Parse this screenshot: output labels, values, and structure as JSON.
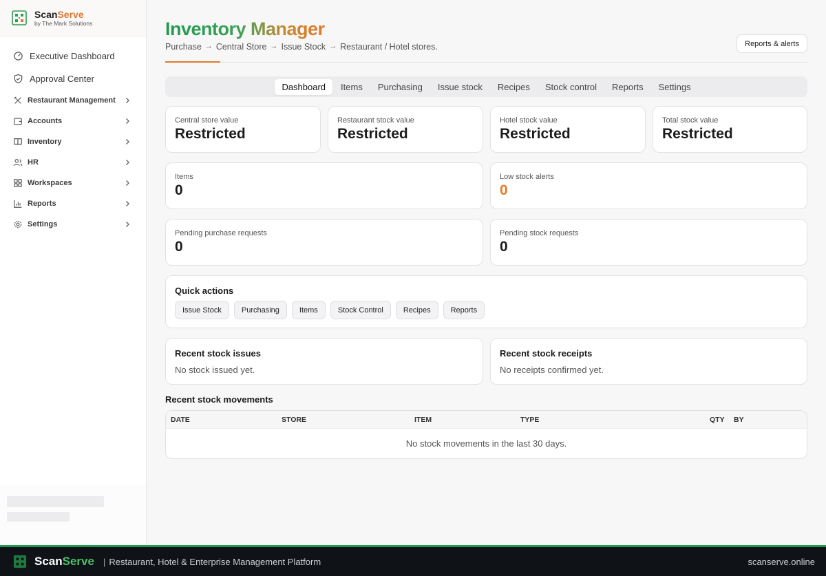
{
  "brand": {
    "name_part1": "Scan",
    "name_part2": "Serve",
    "subtitle": "by The Mark Solutions"
  },
  "sidebar": {
    "top_items": [
      {
        "label": "Executive Dashboard",
        "icon": "activity-icon"
      },
      {
        "label": "Approval Center",
        "icon": "shield-check-icon"
      }
    ],
    "groups": [
      {
        "label": "Restaurant Management",
        "icon": "utensils-icon"
      },
      {
        "label": "Accounts",
        "icon": "wallet-icon"
      },
      {
        "label": "Inventory",
        "icon": "book-icon"
      },
      {
        "label": "HR",
        "icon": "users-icon"
      },
      {
        "label": "Workspaces",
        "icon": "grid-icon"
      },
      {
        "label": "Reports",
        "icon": "bar-chart-icon"
      },
      {
        "label": "Settings",
        "icon": "gear-icon"
      }
    ]
  },
  "header": {
    "title": "Inventory Manager",
    "breadcrumb": [
      "Purchase",
      "Central Store",
      "Issue Stock",
      "Restaurant / Hotel stores."
    ],
    "breadcrumb_arrow": "→",
    "reports_button": "Reports & alerts"
  },
  "tabs": [
    "Dashboard",
    "Items",
    "Purchasing",
    "Issue stock",
    "Recipes",
    "Stock control",
    "Reports",
    "Settings"
  ],
  "active_tab": "Dashboard",
  "value_cards": [
    {
      "label": "Central store value",
      "value": "Restricted"
    },
    {
      "label": "Restaurant stock value",
      "value": "Restricted"
    },
    {
      "label": "Hotel stock value",
      "value": "Restricted"
    },
    {
      "label": "Total stock value",
      "value": "Restricted"
    }
  ],
  "stat_cards": {
    "items": {
      "label": "Items",
      "value": "0"
    },
    "low_stock": {
      "label": "Low stock alerts",
      "value": "0"
    },
    "pending_purchase": {
      "label": "Pending purchase requests",
      "value": "0"
    },
    "pending_stock": {
      "label": "Pending stock requests",
      "value": "0"
    }
  },
  "quick_actions": {
    "title": "Quick actions",
    "buttons": [
      "Issue Stock",
      "Purchasing",
      "Items",
      "Stock Control",
      "Recipes",
      "Reports"
    ]
  },
  "recent_issues": {
    "title": "Recent stock issues",
    "empty": "No stock issued yet."
  },
  "recent_receipts": {
    "title": "Recent stock receipts",
    "empty": "No receipts confirmed yet."
  },
  "movements": {
    "title": "Recent stock movements",
    "columns": [
      "DATE",
      "STORE",
      "ITEM",
      "TYPE",
      "QTY",
      "BY"
    ],
    "empty": "No stock movements in the last 30 days."
  },
  "footer": {
    "brand_part1": "Scan",
    "brand_part2": "Serve",
    "separator": "|",
    "tagline": "Restaurant, Hotel & Enterprise Management Platform",
    "domain": "scanserve.online"
  },
  "colors": {
    "accent_orange": "#e07a2b",
    "brand_green": "#1e9a4f",
    "alert_orange": "#e67b22"
  }
}
